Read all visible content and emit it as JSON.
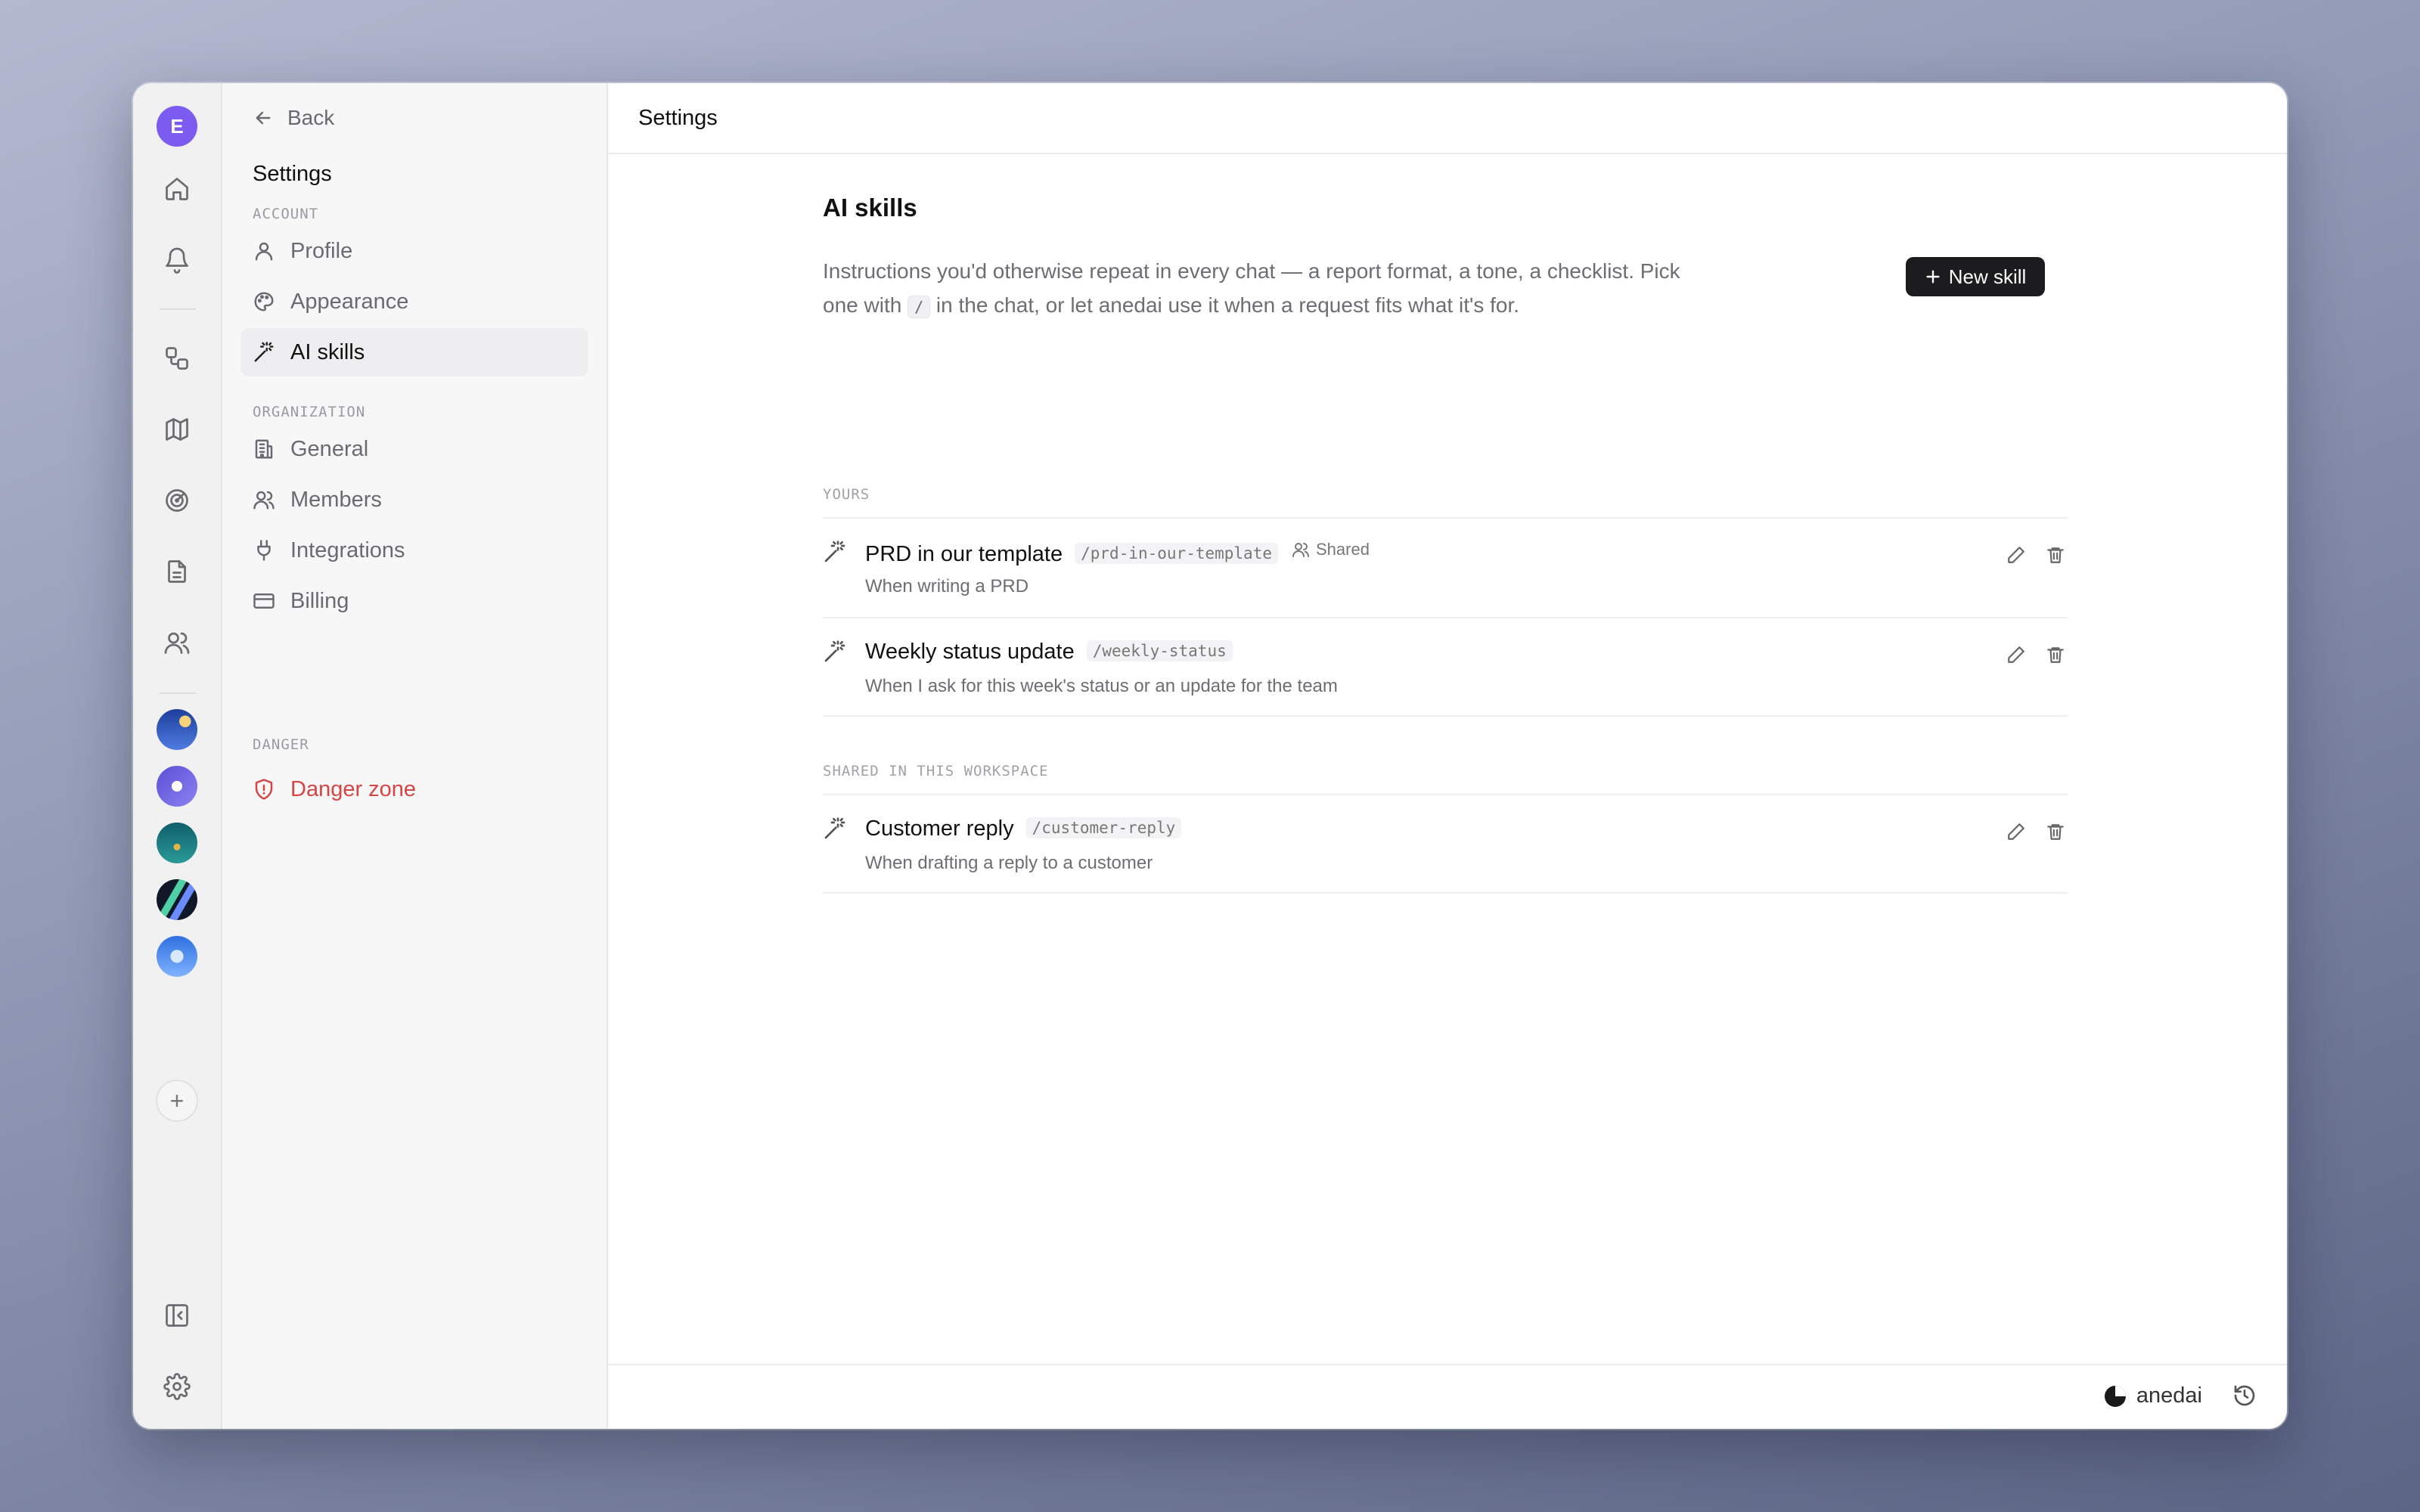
{
  "rail": {
    "user_initial": "E",
    "items": [
      {
        "icon": "home-icon"
      },
      {
        "icon": "bell-icon"
      },
      {
        "icon": "workflow-icon"
      },
      {
        "icon": "map-icon"
      },
      {
        "icon": "radar-icon"
      },
      {
        "icon": "document-icon"
      },
      {
        "icon": "users-icon"
      }
    ],
    "workspaces": [
      {
        "name": "workspace-night",
        "colors": [
          "#1d3f9c",
          "#4f7be0"
        ]
      },
      {
        "name": "workspace-planet",
        "colors": [
          "#5a4fd6",
          "#8c83f2"
        ]
      },
      {
        "name": "workspace-forest",
        "colors": [
          "#0f5f6b",
          "#2a9a98"
        ]
      },
      {
        "name": "workspace-stripes",
        "colors": [
          "#111827",
          "#4fd1a5"
        ]
      },
      {
        "name": "workspace-cube",
        "colors": [
          "#2f6fe0",
          "#7fb2ff"
        ]
      }
    ],
    "add_label": "+"
  },
  "nav": {
    "back_label": "Back",
    "title": "Settings",
    "sections": {
      "account": "ACCOUNT",
      "organization": "ORGANIZATION",
      "danger": "DANGER"
    },
    "items": {
      "profile": "Profile",
      "appearance": "Appearance",
      "ai_skills": "AI skills",
      "general": "General",
      "members": "Members",
      "integrations": "Integrations",
      "billing": "Billing",
      "danger_zone": "Danger zone"
    },
    "active": "ai_skills"
  },
  "topbar": {
    "title": "Settings"
  },
  "page": {
    "heading": "AI skills",
    "description_1": "Instructions you'd otherwise repeat in every chat — a report format, a tone, a checklist. Pick one with",
    "description_kbd": "/",
    "description_2": "in the chat, or let anedai use it when a request fits what it's for.",
    "new_skill_label": "New skill"
  },
  "groups": {
    "yours": "YOURS",
    "shared": "SHARED IN THIS WORKSPACE"
  },
  "skills": [
    {
      "name": "PRD in our template",
      "slug": "/prd-in-our-template",
      "shared_label": "Shared",
      "trigger": "When writing a PRD"
    },
    {
      "name": "Weekly status update",
      "slug": "/weekly-status",
      "trigger": "When I ask for this week's status or an update for the team"
    },
    {
      "name": "Customer reply",
      "slug": "/customer-reply",
      "trigger": "When drafting a reply to a customer"
    }
  ],
  "footer": {
    "brand": "anedai"
  },
  "colors": {
    "accent": "#1c1c1e",
    "danger": "#d64545",
    "user_avatar": "#7c5cf0"
  }
}
